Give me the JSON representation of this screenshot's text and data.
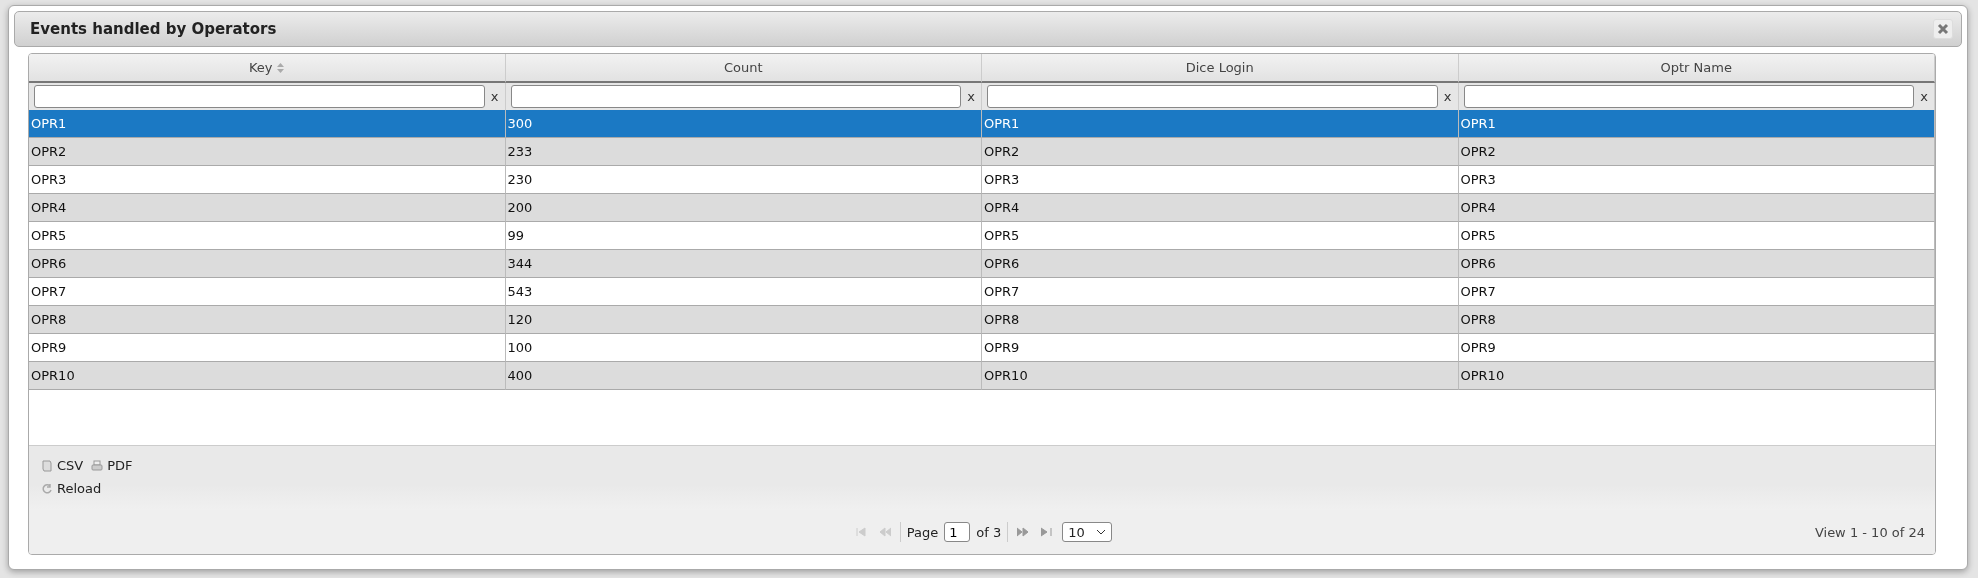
{
  "dialog": {
    "title": "Events handled by Operators"
  },
  "table": {
    "columns": [
      {
        "label": "Key",
        "sortable": true
      },
      {
        "label": "Count",
        "sortable": false
      },
      {
        "label": "Dice Login",
        "sortable": false
      },
      {
        "label": "Optr Name",
        "sortable": false
      }
    ],
    "filters": [
      {
        "clear": "x"
      },
      {
        "clear": "x"
      },
      {
        "clear": "x"
      },
      {
        "clear": "x"
      }
    ],
    "rows": [
      {
        "cells": [
          "OPR1",
          "300",
          "OPR1",
          "OPR1"
        ],
        "selected": true
      },
      {
        "cells": [
          "OPR2",
          "233",
          "OPR2",
          "OPR2"
        ],
        "selected": false
      },
      {
        "cells": [
          "OPR3",
          "230",
          "OPR3",
          "OPR3"
        ],
        "selected": false
      },
      {
        "cells": [
          "OPR4",
          "200",
          "OPR4",
          "OPR4"
        ],
        "selected": false
      },
      {
        "cells": [
          "OPR5",
          "99",
          "OPR5",
          "OPR5"
        ],
        "selected": false
      },
      {
        "cells": [
          "OPR6",
          "344",
          "OPR6",
          "OPR6"
        ],
        "selected": false
      },
      {
        "cells": [
          "OPR7",
          "543",
          "OPR7",
          "OPR7"
        ],
        "selected": false
      },
      {
        "cells": [
          "OPR8",
          "120",
          "OPR8",
          "OPR8"
        ],
        "selected": false
      },
      {
        "cells": [
          "OPR9",
          "100",
          "OPR9",
          "OPR9"
        ],
        "selected": false
      },
      {
        "cells": [
          "OPR10",
          "400",
          "OPR10",
          "OPR10"
        ],
        "selected": false
      }
    ]
  },
  "toolbar": [
    {
      "kind": "csv",
      "label": "CSV"
    },
    {
      "kind": "pdf",
      "label": "PDF"
    },
    {
      "kind": "reload",
      "label": "Reload"
    }
  ],
  "pager": {
    "nav": [
      {
        "kind": "first",
        "disabled": true
      },
      {
        "kind": "prev",
        "disabled": true
      },
      {
        "kind": "next",
        "disabled": false
      },
      {
        "kind": "last",
        "disabled": false
      }
    ],
    "page_label": "Page",
    "page": "1",
    "of": "of 3",
    "page_size": "10",
    "view": "View 1 - 10 of 24"
  }
}
